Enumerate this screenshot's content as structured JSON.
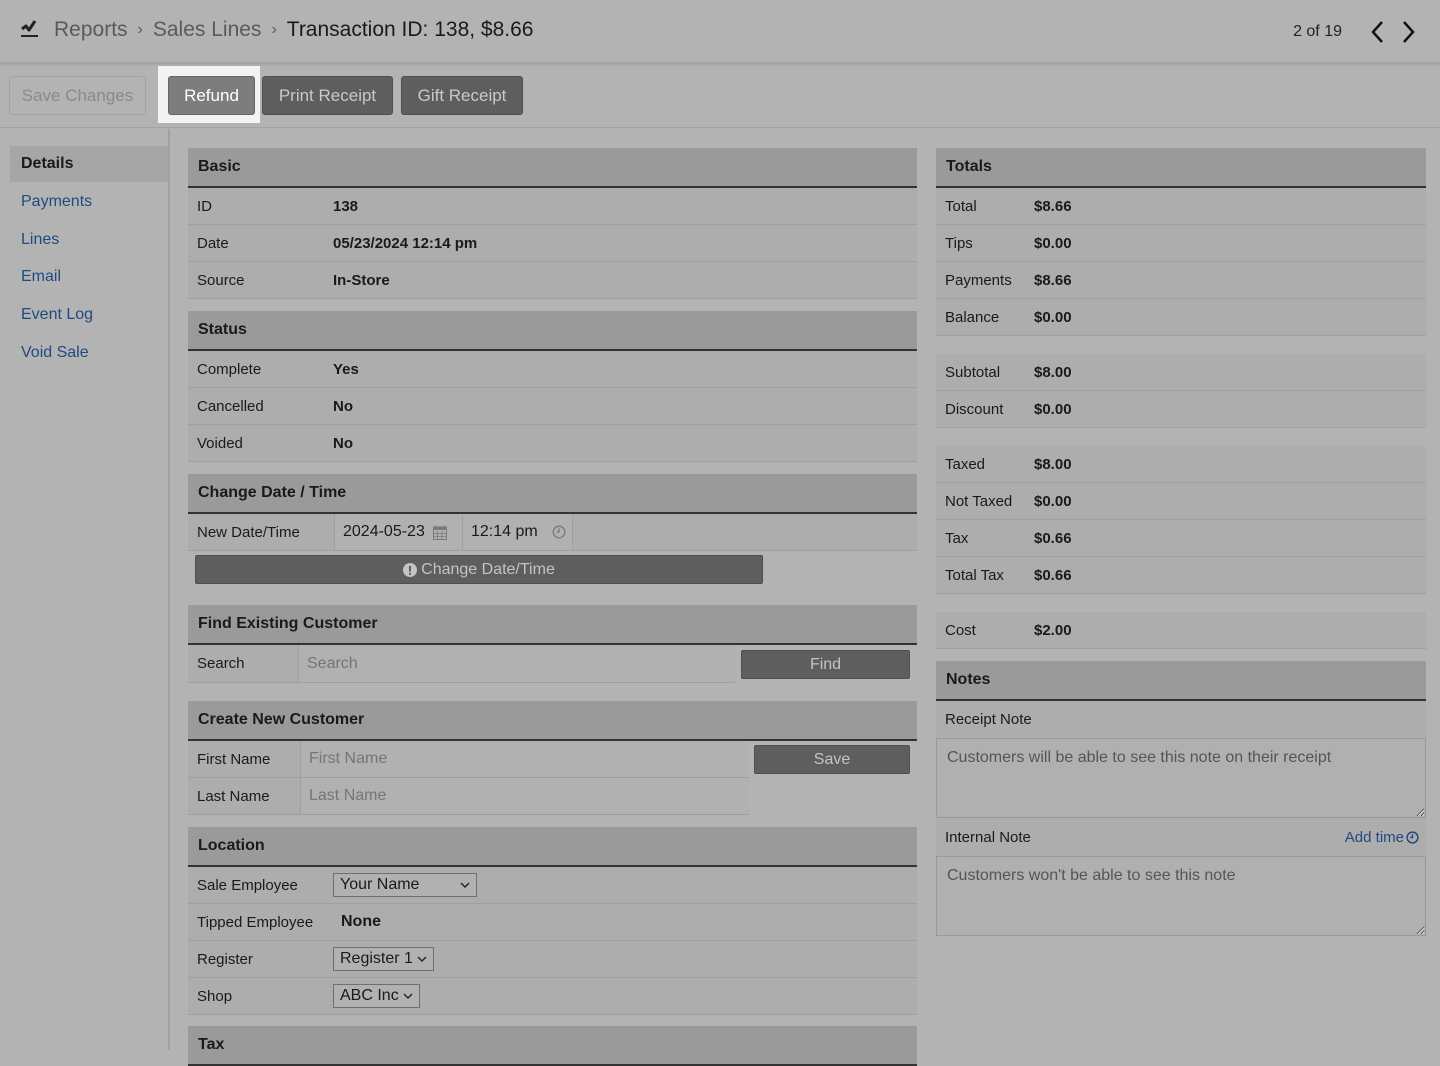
{
  "header": {
    "home_icon": "chart-line-icon",
    "breadcrumbs": [
      "Reports",
      "Sales Lines"
    ],
    "title": "Transaction ID: 138, $8.66",
    "pager": {
      "count": "2 of 19",
      "prev_icon": "chevron-left-icon",
      "next_icon": "chevron-right-icon"
    }
  },
  "toolbar": {
    "save_label": "Save Changes",
    "refund_label": "Refund",
    "print_label": "Print Receipt",
    "gift_label": "Gift Receipt"
  },
  "sidebar": {
    "items": [
      {
        "label": "Details",
        "active": true
      },
      {
        "label": "Payments"
      },
      {
        "label": "Lines"
      },
      {
        "label": "Email"
      },
      {
        "label": "Event Log"
      },
      {
        "label": "Void Sale"
      }
    ]
  },
  "basic": {
    "title": "Basic",
    "rows": [
      {
        "label": "ID",
        "value": "138"
      },
      {
        "label": "Date",
        "value": "05/23/2024 12:14 pm"
      },
      {
        "label": "Source",
        "value": "In-Store"
      }
    ]
  },
  "status": {
    "title": "Status",
    "rows": [
      {
        "label": "Complete",
        "value": "Yes"
      },
      {
        "label": "Cancelled",
        "value": "No"
      },
      {
        "label": "Voided",
        "value": "No"
      }
    ]
  },
  "change_datetime": {
    "title": "Change Date / Time",
    "label": "New Date/Time",
    "date_value": "2024-05-23",
    "date_icon": "calendar-icon",
    "time_value": "12:14 pm",
    "time_icon": "clock-icon",
    "button_label": "Change Date/Time",
    "button_icon": "exclamation-circle-icon"
  },
  "find_customer": {
    "title": "Find Existing Customer",
    "label": "Search",
    "placeholder": "Search",
    "button_label": "Find"
  },
  "create_customer": {
    "title": "Create New Customer",
    "first_label": "First Name",
    "first_placeholder": "First Name",
    "last_label": "Last Name",
    "last_placeholder": "Last Name",
    "button_label": "Save"
  },
  "location": {
    "title": "Location",
    "sale_employee_label": "Sale Employee",
    "sale_employee_value": "Your Name",
    "tipped_employee_label": "Tipped Employee",
    "tipped_employee_value": "None",
    "register_label": "Register",
    "register_value": "Register 1",
    "shop_label": "Shop",
    "shop_value": "ABC Inc"
  },
  "tax": {
    "title": "Tax"
  },
  "totals": {
    "title": "Totals",
    "group1": [
      {
        "label": "Total",
        "value": "$8.66"
      },
      {
        "label": "Tips",
        "value": "$0.00"
      },
      {
        "label": "Payments",
        "value": "$8.66"
      },
      {
        "label": "Balance",
        "value": "$0.00"
      }
    ],
    "group2": [
      {
        "label": "Subtotal",
        "value": "$8.00"
      },
      {
        "label": "Discount",
        "value": "$0.00"
      }
    ],
    "group3": [
      {
        "label": "Taxed",
        "value": "$8.00"
      },
      {
        "label": "Not Taxed",
        "value": "$0.00"
      },
      {
        "label": "Tax",
        "value": "$0.66"
      },
      {
        "label": "Total Tax",
        "value": "$0.66"
      }
    ],
    "group4": [
      {
        "label": "Cost",
        "value": "$2.00"
      }
    ]
  },
  "notes": {
    "title": "Notes",
    "receipt_label": "Receipt Note",
    "receipt_placeholder": "Customers will be able to see this note on their receipt",
    "internal_label": "Internal Note",
    "add_time_label": "Add time",
    "add_time_icon": "clock-icon",
    "internal_placeholder": "Customers won't be able to see this note"
  },
  "colors": {
    "link": "#1f4a80",
    "dark_button": "#5e5e5e",
    "highlight": "#f3f3f3"
  }
}
